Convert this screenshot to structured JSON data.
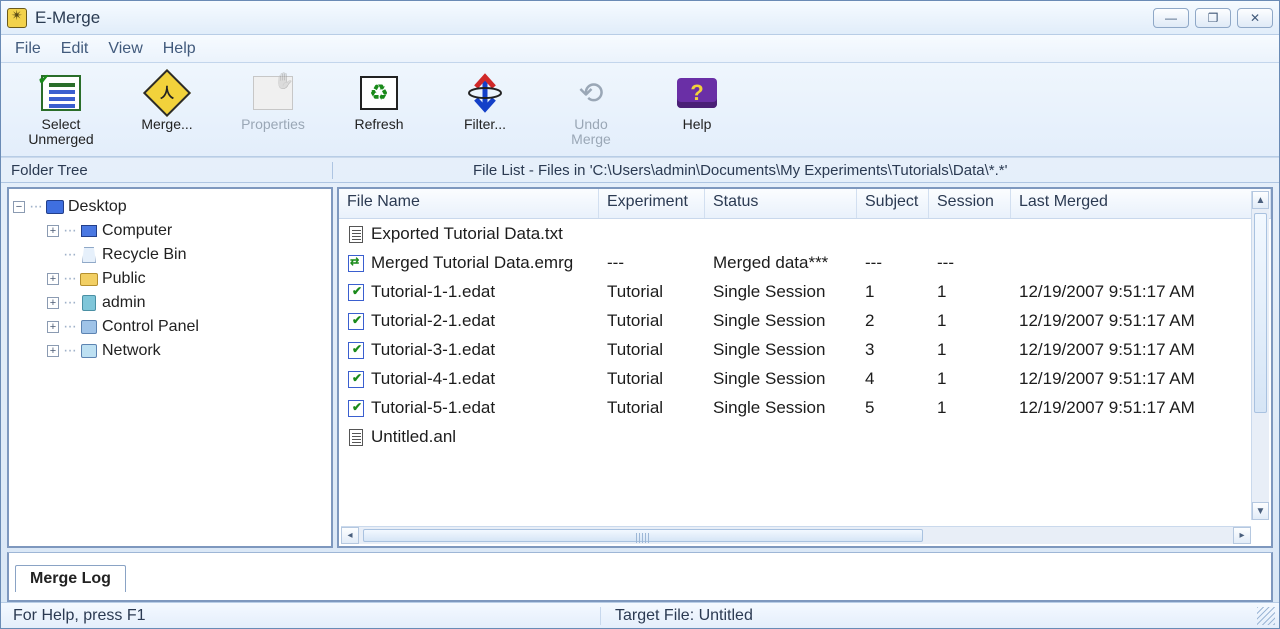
{
  "window": {
    "title": "E-Merge"
  },
  "menu": {
    "file": "File",
    "edit": "Edit",
    "view": "View",
    "help": "Help"
  },
  "toolbar": {
    "select_unmerged": "Select\nUnmerged",
    "merge": "Merge...",
    "properties": "Properties",
    "refresh": "Refresh",
    "filter": "Filter...",
    "undo_merge": "Undo\nMerge",
    "help": "Help"
  },
  "paneheaders": {
    "folder_tree": "Folder Tree",
    "file_list": "File List - Files in 'C:\\Users\\admin\\Documents\\My Experiments\\Tutorials\\Data\\*.*'"
  },
  "tree": {
    "desktop": "Desktop",
    "children": [
      {
        "label": "Computer",
        "expandable": true,
        "icon": "computer"
      },
      {
        "label": "Recycle Bin",
        "expandable": false,
        "icon": "recycle"
      },
      {
        "label": "Public",
        "expandable": true,
        "icon": "folder"
      },
      {
        "label": "admin",
        "expandable": true,
        "icon": "admin"
      },
      {
        "label": "Control Panel",
        "expandable": true,
        "icon": "cpanel"
      },
      {
        "label": "Network",
        "expandable": true,
        "icon": "network"
      }
    ]
  },
  "columns": {
    "name": "File Name",
    "experiment": "Experiment",
    "status": "Status",
    "subject": "Subject",
    "session": "Session",
    "last_merged": "Last Merged"
  },
  "files": [
    {
      "icon": "txt",
      "name": "Exported Tutorial Data.txt",
      "experiment": "",
      "status": "",
      "subject": "",
      "session": "",
      "last_merged": ""
    },
    {
      "icon": "emrg",
      "name": "Merged Tutorial Data.emrg",
      "experiment": "---",
      "status": "Merged data***",
      "subject": "---",
      "session": "---",
      "last_merged": ""
    },
    {
      "icon": "edat",
      "name": "Tutorial-1-1.edat",
      "experiment": "Tutorial",
      "status": "Single Session",
      "subject": "1",
      "session": "1",
      "last_merged": "12/19/2007 9:51:17 AM"
    },
    {
      "icon": "edat",
      "name": "Tutorial-2-1.edat",
      "experiment": "Tutorial",
      "status": "Single Session",
      "subject": "2",
      "session": "1",
      "last_merged": "12/19/2007 9:51:17 AM"
    },
    {
      "icon": "edat",
      "name": "Tutorial-3-1.edat",
      "experiment": "Tutorial",
      "status": "Single Session",
      "subject": "3",
      "session": "1",
      "last_merged": "12/19/2007 9:51:17 AM"
    },
    {
      "icon": "edat",
      "name": "Tutorial-4-1.edat",
      "experiment": "Tutorial",
      "status": "Single Session",
      "subject": "4",
      "session": "1",
      "last_merged": "12/19/2007 9:51:17 AM"
    },
    {
      "icon": "edat",
      "name": "Tutorial-5-1.edat",
      "experiment": "Tutorial",
      "status": "Single Session",
      "subject": "5",
      "session": "1",
      "last_merged": "12/19/2007 9:51:17 AM"
    },
    {
      "icon": "txt",
      "name": "Untitled.anl",
      "experiment": "",
      "status": "",
      "subject": "",
      "session": "",
      "last_merged": ""
    }
  ],
  "mergelog_tab": "Merge Log",
  "statusbar": {
    "help": "For Help, press F1",
    "target": "Target File: Untitled"
  }
}
